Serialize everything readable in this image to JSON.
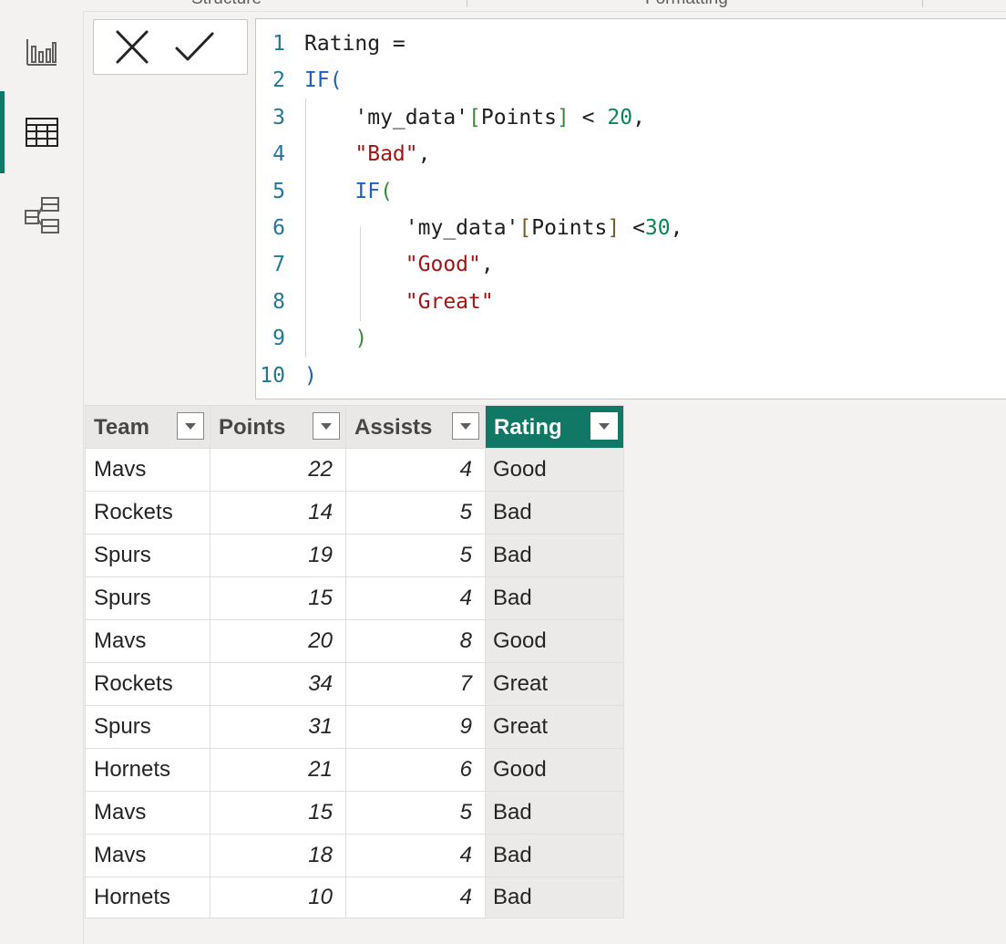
{
  "ribbon": {
    "groups": [
      "Structure",
      "Formatting"
    ]
  },
  "rail": {
    "items": [
      {
        "id": "report",
        "icon": "report-view-icon",
        "active": false
      },
      {
        "id": "data",
        "icon": "data-view-icon",
        "active": true
      },
      {
        "id": "model",
        "icon": "model-view-icon",
        "active": false
      }
    ]
  },
  "formula": {
    "lines": [
      {
        "n": "1",
        "tokens": [
          [
            "Rating = ",
            "id"
          ]
        ]
      },
      {
        "n": "2",
        "tokens": [
          [
            "IF",
            "kw"
          ],
          [
            "(",
            "br1"
          ]
        ]
      },
      {
        "n": "3",
        "tokens": [
          [
            "    'my_data'",
            "id"
          ],
          [
            "[",
            "br2"
          ],
          [
            "Points",
            "col"
          ],
          [
            "]",
            "br2"
          ],
          [
            " < ",
            "id"
          ],
          [
            "20",
            "num"
          ],
          [
            ",",
            "id"
          ]
        ]
      },
      {
        "n": "4",
        "tokens": [
          [
            "    ",
            "id"
          ],
          [
            "\"Bad\"",
            "str"
          ],
          [
            ",",
            "id"
          ]
        ]
      },
      {
        "n": "5",
        "tokens": [
          [
            "    ",
            "id"
          ],
          [
            "IF",
            "kw"
          ],
          [
            "(",
            "br2"
          ]
        ]
      },
      {
        "n": "6",
        "tokens": [
          [
            "        'my_data'",
            "id"
          ],
          [
            "[",
            "br3"
          ],
          [
            "Points",
            "col"
          ],
          [
            "]",
            "br3"
          ],
          [
            " <",
            "id"
          ],
          [
            "30",
            "num"
          ],
          [
            ",",
            "id"
          ]
        ]
      },
      {
        "n": "7",
        "tokens": [
          [
            "        ",
            "id"
          ],
          [
            "\"Good\"",
            "str"
          ],
          [
            ",",
            "id"
          ]
        ]
      },
      {
        "n": "8",
        "tokens": [
          [
            "        ",
            "id"
          ],
          [
            "\"Great\"",
            "str"
          ]
        ]
      },
      {
        "n": "9",
        "tokens": [
          [
            "    ",
            "id"
          ],
          [
            ")",
            "br2"
          ]
        ]
      },
      {
        "n": "10",
        "tokens": [
          [
            ")",
            "br1"
          ]
        ]
      }
    ]
  },
  "table": {
    "columns": [
      "Team",
      "Points",
      "Assists",
      "Rating"
    ],
    "selected_column": "Rating",
    "rows": [
      [
        "Mavs",
        "22",
        "4",
        "Good"
      ],
      [
        "Rockets",
        "14",
        "5",
        "Bad"
      ],
      [
        "Spurs",
        "19",
        "5",
        "Bad"
      ],
      [
        "Spurs",
        "15",
        "4",
        "Bad"
      ],
      [
        "Mavs",
        "20",
        "8",
        "Good"
      ],
      [
        "Rockets",
        "34",
        "7",
        "Great"
      ],
      [
        "Spurs",
        "31",
        "9",
        "Great"
      ],
      [
        "Hornets",
        "21",
        "6",
        "Good"
      ],
      [
        "Mavs",
        "15",
        "5",
        "Bad"
      ],
      [
        "Mavs",
        "18",
        "4",
        "Bad"
      ],
      [
        "Hornets",
        "10",
        "4",
        "Bad"
      ]
    ]
  },
  "colors": {
    "accent": "#117865",
    "keyword": "#1f5fbf",
    "string": "#a31515",
    "number": "#098658"
  }
}
